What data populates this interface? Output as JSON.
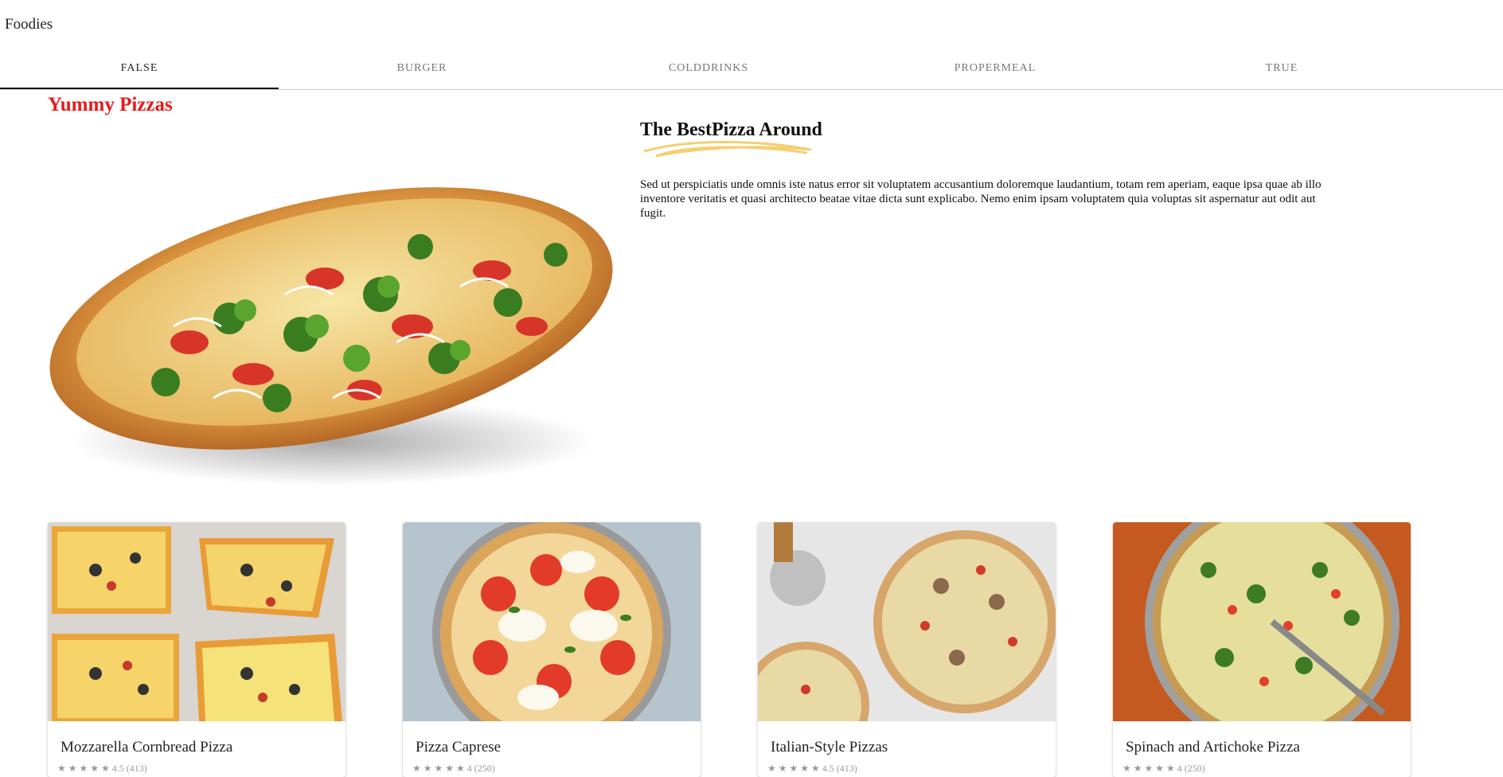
{
  "brand": "Foodies",
  "tabs": [
    "FALSE",
    "BURGER",
    "COLDDRINKS",
    "PROPERMEAL",
    "TRUE"
  ],
  "hero": {
    "heading": "Yummy Pizzas",
    "title": "The BestPizza Around",
    "text": "Sed ut perspiciatis unde omnis iste natus error sit voluptatem accusantium doloremque laudantium, totam rem aperiam, eaque ipsa quae ab illo inventore veritatis et quasi architecto beatae vitae dicta sunt explicabo. Nemo enim ipsam voluptatem quia voluptas sit aspernatur aut odit aut fugit."
  },
  "cards": [
    {
      "name": "Mozzarella Cornbread Pizza",
      "rating": "★ ★ ★ ★ ★ 4.5 (413)"
    },
    {
      "name": "Pizza Caprese",
      "rating": "★ ★ ★ ★ ★ 4 (250)"
    },
    {
      "name": "Italian-Style Pizzas",
      "rating": "★ ★ ★ ★ ★ 4.5 (413)"
    },
    {
      "name": "Spinach and Artichoke Pizza",
      "rating": "★ ★ ★ ★ ★ 4 (250)"
    }
  ],
  "colors": {
    "heading_red": "#e51b1b",
    "swash_gold": "#f2cf72"
  }
}
